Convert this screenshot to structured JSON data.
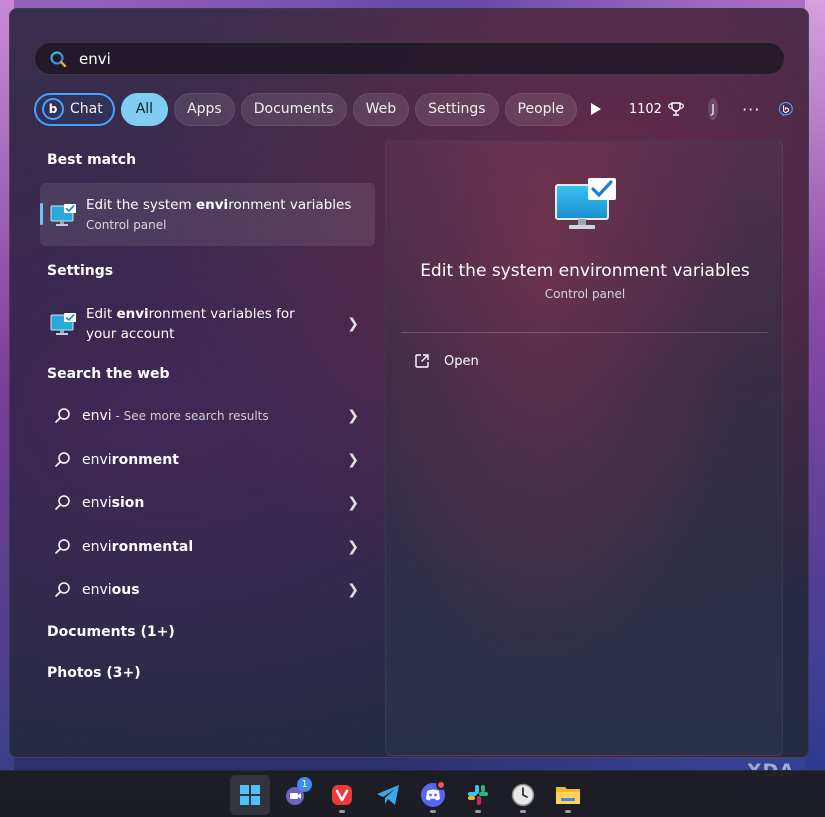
{
  "search": {
    "query": "envi"
  },
  "filters": {
    "chat": "Chat",
    "tabs": [
      "All",
      "Apps",
      "Documents",
      "Web",
      "Settings",
      "People"
    ],
    "points": "1102",
    "avatar_initial": "J",
    "more": "···"
  },
  "best_match": {
    "heading": "Best match",
    "title_pre": "Edit the system ",
    "title_bold": "envi",
    "title_post": "ronment variables",
    "subtitle": "Control panel"
  },
  "settings": {
    "heading": "Settings",
    "line1_pre": "Edit ",
    "line1_bold": "envi",
    "line1_post": "ronment variables for",
    "line2": "your account"
  },
  "web": {
    "heading": "Search the web",
    "first_query": "envi",
    "first_hint": " - See more search results",
    "suggestions": [
      {
        "bold_prefix": "envi",
        "rest": "ronment"
      },
      {
        "bold_prefix": "envi",
        "rest": "sion"
      },
      {
        "bold_prefix": "envi",
        "rest": "ronmental"
      },
      {
        "bold_prefix": "envi",
        "rest": "ous"
      }
    ]
  },
  "other_sections": {
    "documents": "Documents (1+)",
    "photos": "Photos (3+)"
  },
  "preview": {
    "title": "Edit the system environment variables",
    "subtitle": "Control panel",
    "action_open": "Open"
  },
  "taskbar": {
    "meet_badge": "1"
  },
  "watermark": "XDA",
  "colors": {
    "accent": "#7fcdf2",
    "chat_border": "#4aa0ff"
  }
}
